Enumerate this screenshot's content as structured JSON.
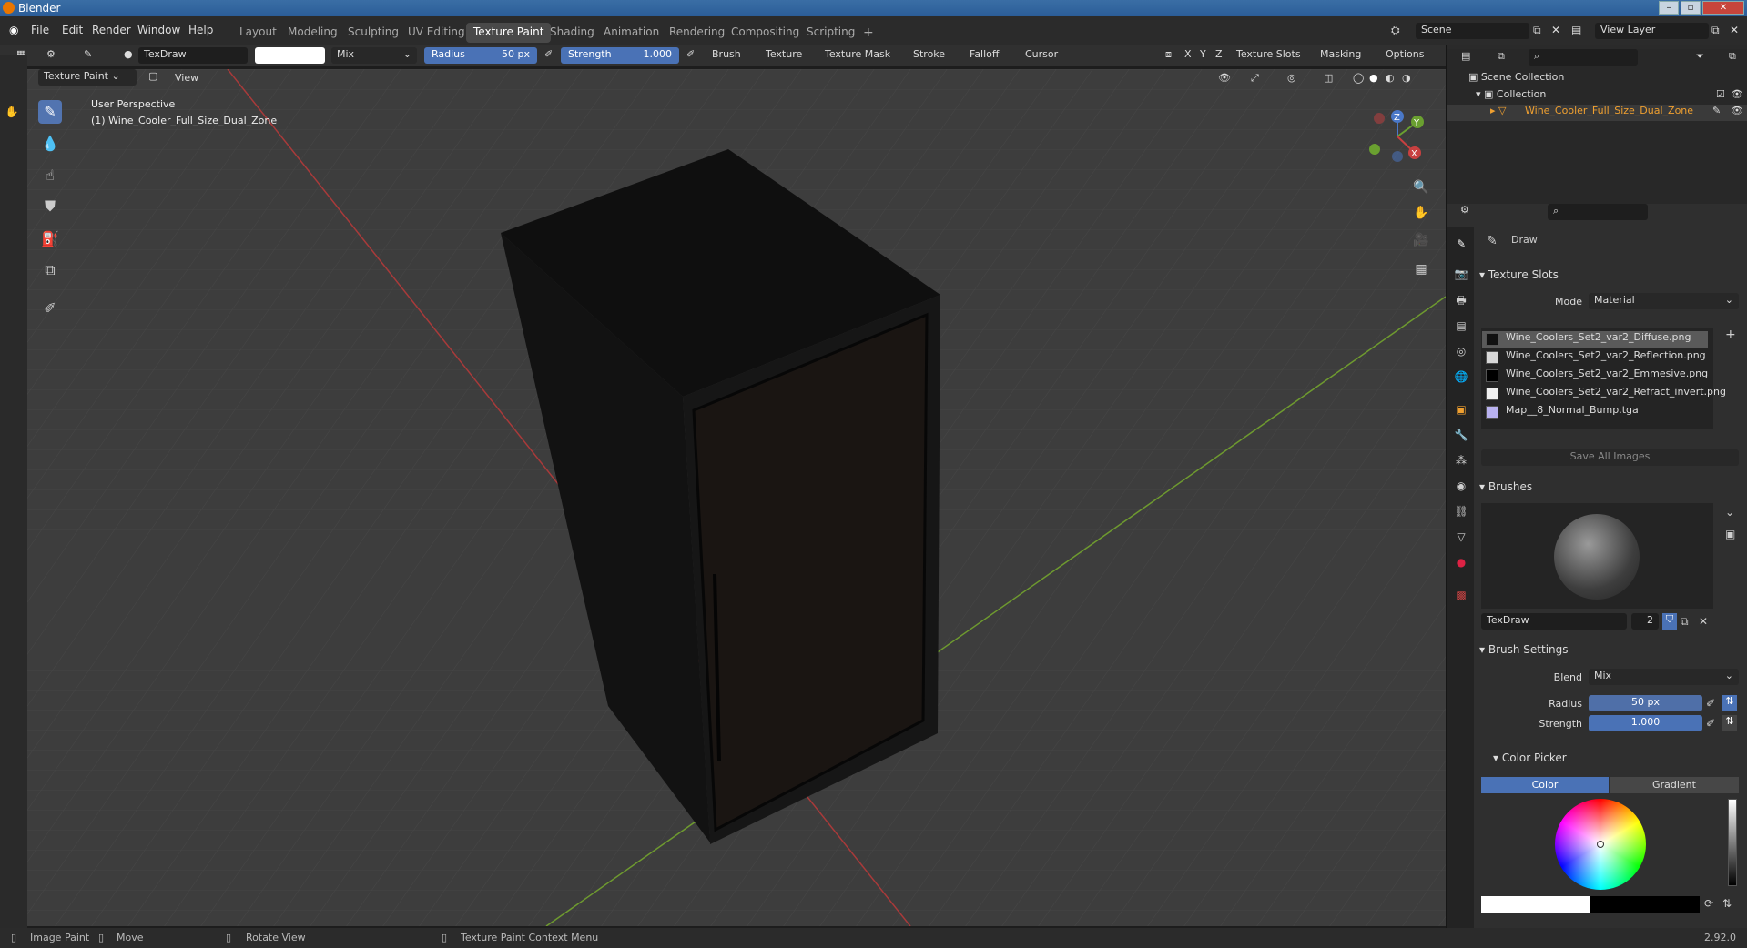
{
  "app": {
    "title": "Blender",
    "version": "2.92.0"
  },
  "menu": {
    "items": [
      "File",
      "Edit",
      "Render",
      "Window",
      "Help"
    ]
  },
  "workspaces": [
    "Layout",
    "Modeling",
    "Sculpting",
    "UV Editing",
    "Texture Paint",
    "Shading",
    "Animation",
    "Rendering",
    "Compositing",
    "Scripting"
  ],
  "active_workspace": "Texture Paint",
  "scene": {
    "label": "Scene",
    "view_layer": "View Layer"
  },
  "header": {
    "brush_name": "TexDraw",
    "blend": "Mix",
    "radius_label": "Radius",
    "radius_value": "50 px",
    "strength_label": "Strength",
    "strength_value": "1.000",
    "menus": [
      "Brush",
      "Texture",
      "Texture Mask",
      "Stroke",
      "Falloff",
      "Cursor"
    ],
    "axes": [
      "X",
      "Y",
      "Z"
    ],
    "right_menus": [
      "Texture Slots",
      "Masking",
      "Options"
    ],
    "mode": "Texture Paint",
    "view": "View"
  },
  "viewport": {
    "perspective": "User Perspective",
    "object": "(1) Wine_Cooler_Full_Size_Dual_Zone",
    "gizmo": {
      "x": "X",
      "y": "Y",
      "z": "Z"
    }
  },
  "outliner": {
    "scene_collection": "Scene Collection",
    "collection": "Collection",
    "object": "Wine_Cooler_Full_Size_Dual_Zone"
  },
  "properties": {
    "tool_name": "Draw",
    "texture_slots": {
      "title": "Texture Slots",
      "mode_label": "Mode",
      "mode_value": "Material",
      "slots": [
        {
          "name": "Wine_Coolers_Set2_var2_Diffuse.png",
          "color": "#111111"
        },
        {
          "name": "Wine_Coolers_Set2_var2_Reflection.png",
          "color": "#d8d8d8"
        },
        {
          "name": "Wine_Coolers_Set2_var2_Emmesive.png",
          "color": "#000000"
        },
        {
          "name": "Wine_Coolers_Set2_var2_Refract_invert.png",
          "color": "#f0f0f0"
        },
        {
          "name": "Map__8_Normal_Bump.tga",
          "color": "#b9b2f0"
        }
      ],
      "save_all": "Save All Images"
    },
    "brushes": {
      "title": "Brushes",
      "name": "TexDraw",
      "users": "2"
    },
    "brush_settings": {
      "title": "Brush Settings",
      "blend_label": "Blend",
      "blend_value": "Mix",
      "radius_label": "Radius",
      "radius_value": "50 px",
      "strength_label": "Strength",
      "strength_value": "1.000"
    },
    "color_picker": {
      "title": "Color Picker",
      "color_tab": "Color",
      "gradient_tab": "Gradient"
    }
  },
  "statusbar": {
    "items": [
      "Image Paint",
      "Move",
      "Rotate View",
      "Texture Paint Context Menu"
    ],
    "version": "2.92.0"
  },
  "colors": {
    "accent": "#4a72b6",
    "active_object": "#f0a030",
    "bg": "#3d3d3d"
  }
}
